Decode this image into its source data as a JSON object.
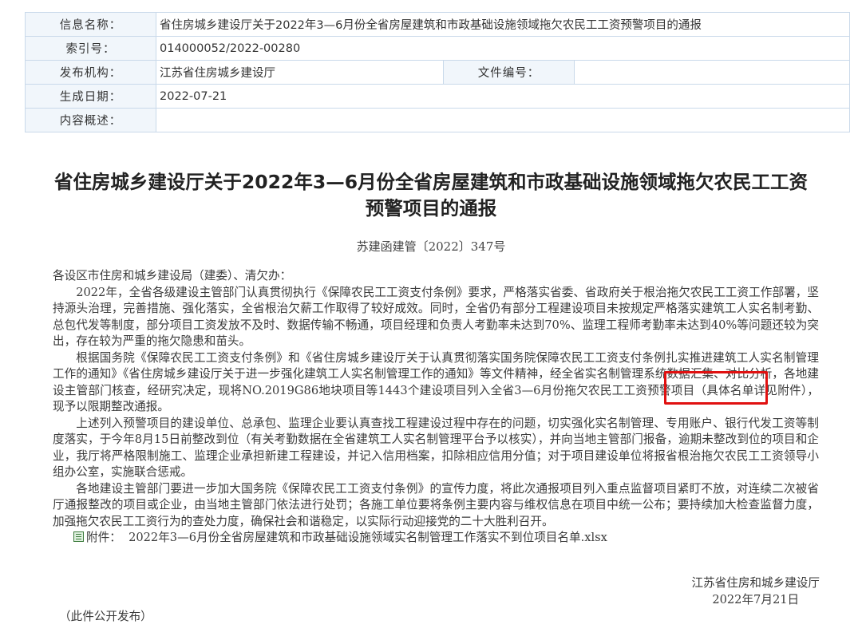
{
  "meta": {
    "title_label": "信息名称：",
    "title_value": "省住房城乡建设厅关于2022年3—6月份全省房屋建筑和市政基础设施领域拖欠农民工工资预警项目的通报",
    "index_label": "索引号：",
    "index_value": "014000052/2022-00280",
    "publisher_label": "发布机构：",
    "publisher_value": "江苏省住房城乡建设厅",
    "docnum_label": "文件编号：",
    "docnum_value": "",
    "date_label": "生成日期：",
    "date_value": "2022-07-21",
    "summary_label": "内容概述：",
    "summary_value": ""
  },
  "document": {
    "title_line1": "省住房城乡建设厅关于2022年3—6月份全省房屋建筑和市政基础设施领域拖欠农民工工资",
    "title_line2": "预警项目的通报",
    "doc_number": "苏建函建管〔2022〕347号",
    "salutation": "各设区市住房和城乡建设局（建委）、清欠办：",
    "para1": "2022年，全省各级建设主管部门认真贯彻执行《保障农民工工资支付条例》要求，严格落实省委、省政府关于根治拖欠农民工工资工作部署，坚持源头治理，完善措施、强化落实，全省根治欠薪工作取得了较好成效。同时，全省仍有部分工程建设项目未按规定严格落实建筑工人实名制考勤、总包代发等制度，部分项目工资发放不及时、数据传输不畅通，项目经理和负责人考勤率未达到70%、监理工程师考勤率未达到40%等问题还较为突出，存在较为严重的拖欠隐患和苗头。",
    "para2": "根据国务院《保障农民工工资支付条例》和《省住房城乡建设厅关于认真贯彻落实国务院保障农民工工资支付条例扎实推进建筑工人实名制管理工作的通知》《省住房城乡建设厅关于进一步强化建筑工人实名制管理工作的通知》等文件精神，经全省实名制管理系统数据汇集、对比分析，各地建设主管部门核查，经研究决定，现将NO.2019G86地块项目等1443个建设项目列入全省3—6月份拖欠农民工工资预警项目（具体名单详见附件），现予以限期整改通报。",
    "para3": "上述列入预警项目的建设单位、总承包、监理企业要认真查找工程建设过程中存在的问题，切实强化实名制管理、专用账户、银行代发工资等制度落实，于今年8月15日前整改到位（有关考勤数据在全省建筑工人实名制管理平台予以核实），并向当地主管部门报备，逾期未整改到位的项目和企业，我厅将严格限制施工、监理企业承担新建工程建设，并记入信用档案，扣除相应信用分值；对于项目建设单位将报省根治拖欠农民工工资领导小组办公室，实施联合惩戒。",
    "para4": "各地建设主管部门要进一步加大国务院《保障农民工工资支付条例》的宣传力度，将此次通报项目列入重点监督项目紧盯不放，对连续二次被省厅通报整改的项目或企业，由当地主管部门依法进行处罚；各施工单位要将条例主要内容与维权信息在项目中统一公布；要持续加大检查监督力度，加强拖欠农民工工资行为的查处力度，确保社会和谐稳定，以实际行动迎接党的二十大胜利召开。",
    "attachment_label": "附件：",
    "attachment_name": "2022年3—6月份全省房屋建筑和市政基础设施领域实名制管理工作落实不到位项目名单.xlsx",
    "signer": "江苏省住房和城乡建设厅",
    "sign_date": "2022年7月21日",
    "footer_note": "（此件公开发布）"
  },
  "colors": {
    "label_bg": "#f1f6fb",
    "border": "#c9d9ea",
    "highlight": "#e01010"
  }
}
